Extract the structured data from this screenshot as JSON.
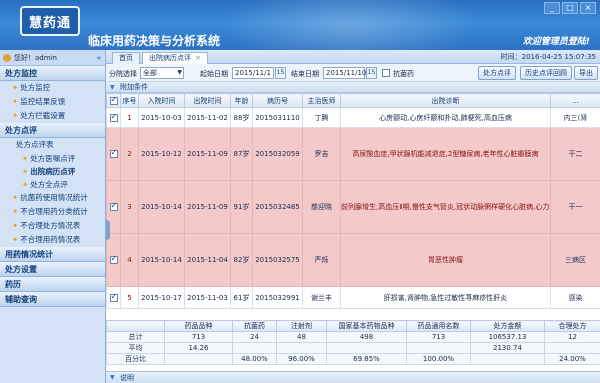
{
  "window": {
    "minimize": "_",
    "maximize": "□",
    "close": "×"
  },
  "header": {
    "logo_text": "慧药通",
    "title": "临床用药决策与分析系统",
    "welcome": "欢迎管理员登陆!"
  },
  "sidebar": {
    "greeting": "您好！admin",
    "collapse": "«",
    "sections": [
      {
        "label": "处方监控",
        "items": [
          {
            "label": "处方监控"
          },
          {
            "label": "监控结果反馈"
          },
          {
            "label": "处方拦截设置"
          }
        ]
      },
      {
        "label": "处方点评",
        "sub": "处方点评表",
        "subitems": [
          {
            "label": "处方医嘱点评"
          },
          {
            "label": "出院病历点评"
          },
          {
            "label": "处方全点评"
          }
        ],
        "items2": [
          {
            "label": "抗菌药使用情况统计"
          },
          {
            "label": "不合理用药分类统计"
          },
          {
            "label": "不合理处方情况表"
          },
          {
            "label": "不合理用药情况表"
          }
        ]
      },
      {
        "label": "用药情况统计"
      },
      {
        "label": "处方设置"
      },
      {
        "label": "药历"
      },
      {
        "label": "辅助查询"
      }
    ]
  },
  "tabs": [
    {
      "label": "首页"
    },
    {
      "label": "出院病历点评",
      "close": "×"
    }
  ],
  "time_label": "时间：2016-04-25 15:07:35",
  "filter": {
    "category_label": "分院选择",
    "category_value": "全部",
    "start_label": "起始日期",
    "start_value": "2015/11/1",
    "end_label": "结束日期",
    "end_value": "2015/11/10",
    "antibiotic_label": "抗菌药",
    "calendar_icon": "15",
    "buttons": {
      "review": "处方点评",
      "history": "历史点评回顾",
      "export": "导出"
    }
  },
  "extra_conditions": "附加条件",
  "table": {
    "headers": [
      "",
      "序号",
      "入院时间",
      "出院时间",
      "年龄",
      "病历号",
      "主治医师",
      "出院诊断",
      "..."
    ],
    "rows": [
      {
        "checked": true,
        "style": "white",
        "no": "1",
        "admit": "2015-10-03",
        "discharge": "2015-11-02",
        "age": "88岁",
        "record": "2015031110",
        "doctor": "丁腾",
        "diagnosis": "心房颤动,心房纤颤和扑动,肺梗死,高血压病",
        "extra": "内三(肾",
        "red": false
      },
      {
        "checked": true,
        "style": "pink",
        "no": "2",
        "admit": "2015-10-12",
        "discharge": "2015-11-09",
        "age": "87岁",
        "record": "2015032059",
        "doctor": "罗吉",
        "diagnosis": "高尿酸血症,甲状腺机能减退症,2型糖尿病,老年性心脏瓣膜病",
        "extra": "干二",
        "red": true
      },
      {
        "checked": true,
        "style": "pink",
        "no": "3",
        "admit": "2015-10-14",
        "discharge": "2015-11-09",
        "age": "91岁",
        "record": "2015032485",
        "doctor": "慈迎晓",
        "diagnosis": "前列腺增生,高血压Ⅱ期,慢性支气管炎,冠状动脉粥样硬化心脏病,心力衰竭",
        "extra": "干一",
        "red": true
      },
      {
        "checked": true,
        "style": "pink",
        "no": "4",
        "admit": "2015-10-14",
        "discharge": "2015-11-04",
        "age": "82岁",
        "record": "2015032575",
        "doctor": "严烁",
        "diagnosis": "胃恶性肿瘤",
        "extra": "三病区",
        "red": true
      },
      {
        "checked": true,
        "style": "white",
        "no": "5",
        "admit": "2015-10-17",
        "discharge": "2015-11-03",
        "age": "61岁",
        "record": "2015032991",
        "doctor": "谢兰丰",
        "diagnosis": "肝损害,肾肿物,急性过敏性荨麻疹性肝炎",
        "extra": "感染",
        "red": false
      }
    ]
  },
  "summary": {
    "headers": [
      "",
      "药品品种",
      "抗菌药",
      "注射剂",
      "国家基本药物品种",
      "药品通用名数",
      "处方金额",
      "合理处方"
    ],
    "rows": [
      [
        "总计",
        "713",
        "24",
        "48",
        "498",
        "713",
        "106537.13",
        "12"
      ],
      [
        "平均",
        "14.26",
        "",
        "",
        "",
        "",
        "2130.74",
        ""
      ],
      [
        "百分比",
        "",
        "48.00%",
        "96.00%",
        "69.85%",
        "100.00%",
        "",
        "24.00%"
      ]
    ]
  },
  "footer_label": "说明"
}
